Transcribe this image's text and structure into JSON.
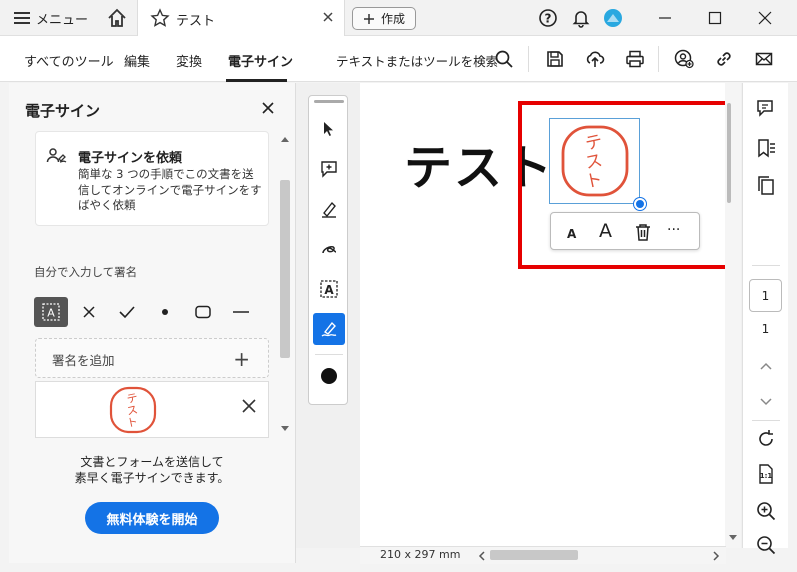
{
  "titlebar": {
    "menu_label": "メニュー",
    "tab_label": "テスト",
    "new_label": "作成"
  },
  "toolbar": {
    "tabs": [
      "すべてのツール",
      "編集",
      "変換",
      "電子サイン"
    ],
    "active_tab": "電子サイン",
    "search_label": "テキストまたはツールを検索"
  },
  "panel": {
    "title": "電子サイン",
    "request_title": "電子サインを依頼",
    "request_desc": "簡単な 3 つの手順でこの文書を送信してオンラインで電子サインをすばやく依頼",
    "section_label": "自分で入力して署名",
    "add_signature_label": "署名を追加",
    "promo_text_1": "文書とフォームを送信して",
    "promo_text_2": "素早く電子サインできます。",
    "cta_label": "無料体験を開始"
  },
  "document": {
    "text": "テスト",
    "stamp_text": "テスト",
    "page_size": "210 x 297 mm"
  },
  "stamp_toolbar": {
    "small_a": "A",
    "large_a": "A",
    "more": "···"
  },
  "pagination": {
    "current": "1",
    "total": "1"
  },
  "colors": {
    "accent": "#1473e6",
    "highlight": "#e60000",
    "stamp": "#e0533a"
  }
}
